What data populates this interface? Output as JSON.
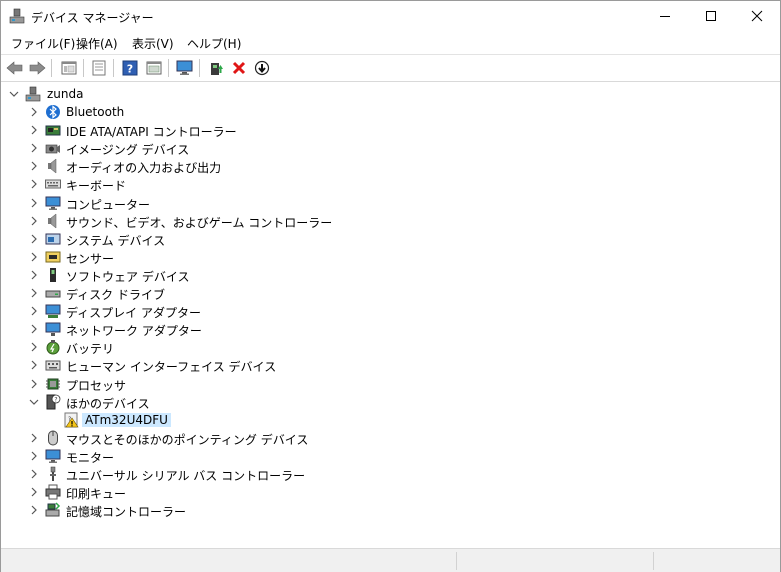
{
  "window": {
    "title": "デバイス マネージャー"
  },
  "menu": [
    "ファイル(F)",
    "操作(A)",
    "表示(V)",
    "ヘルプ(H)"
  ],
  "toolbar": [
    "back-icon",
    "forward-icon",
    "properties-icon",
    "driver-list-icon",
    "help-icon",
    "view-icon",
    "monitor-scan-icon",
    "update-driver-icon",
    "uninstall-icon",
    "disable-icon"
  ],
  "tree": {
    "root": "zunda",
    "items": [
      {
        "label": "Bluetooth",
        "icon": "bluetooth-icon",
        "expanded": false
      },
      {
        "label": "IDE ATA/ATAPI コントローラー",
        "icon": "ide-controller-icon",
        "expanded": false
      },
      {
        "label": "イメージング デバイス",
        "icon": "camera-icon",
        "expanded": false
      },
      {
        "label": "オーディオの入力および出力",
        "icon": "speaker-icon",
        "expanded": false
      },
      {
        "label": "キーボード",
        "icon": "keyboard-icon",
        "expanded": false
      },
      {
        "label": "コンピューター",
        "icon": "computer-icon",
        "expanded": false
      },
      {
        "label": "サウンド、ビデオ、およびゲーム コントローラー",
        "icon": "sound-icon",
        "expanded": false
      },
      {
        "label": "システム デバイス",
        "icon": "system-device-icon",
        "expanded": false
      },
      {
        "label": "センサー",
        "icon": "sensor-icon",
        "expanded": false
      },
      {
        "label": "ソフトウェア デバイス",
        "icon": "software-device-icon",
        "expanded": false
      },
      {
        "label": "ディスク ドライブ",
        "icon": "disk-drive-icon",
        "expanded": false
      },
      {
        "label": "ディスプレイ アダプター",
        "icon": "display-adapter-icon",
        "expanded": false
      },
      {
        "label": "ネットワーク アダプター",
        "icon": "network-adapter-icon",
        "expanded": false
      },
      {
        "label": "バッテリ",
        "icon": "battery-icon",
        "expanded": false
      },
      {
        "label": "ヒューマン インターフェイス デバイス",
        "icon": "hid-icon",
        "expanded": false
      },
      {
        "label": "プロセッサ",
        "icon": "processor-icon",
        "expanded": false
      },
      {
        "label": "ほかのデバイス",
        "icon": "other-device-icon",
        "expanded": true,
        "children": [
          {
            "label": "ATm32U4DFU",
            "icon": "warning-device-icon",
            "selected": true
          }
        ]
      },
      {
        "label": "マウスとそのほかのポインティング デバイス",
        "icon": "mouse-icon",
        "expanded": false
      },
      {
        "label": "モニター",
        "icon": "monitor-icon",
        "expanded": false
      },
      {
        "label": "ユニバーサル シリアル バス コントローラー",
        "icon": "usb-icon",
        "expanded": false
      },
      {
        "label": "印刷キュー",
        "icon": "printer-icon",
        "expanded": false
      },
      {
        "label": "記憶域コントローラー",
        "icon": "storage-controller-icon",
        "expanded": false
      }
    ]
  }
}
